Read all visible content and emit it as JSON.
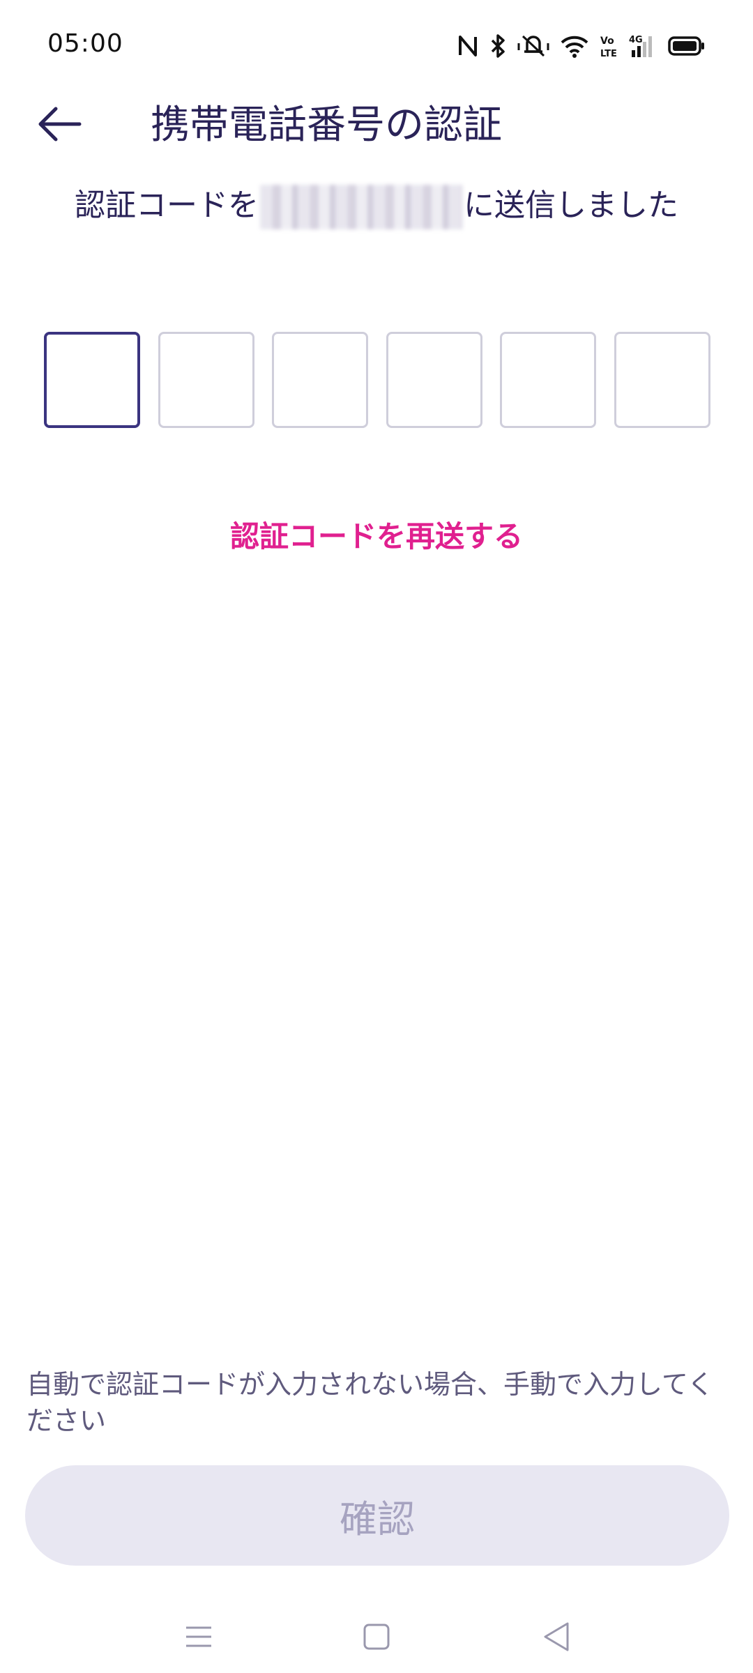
{
  "status_bar": {
    "time": "05:00",
    "icons": [
      "nfc-icon",
      "bluetooth-icon",
      "vibrate-icon",
      "wifi-icon",
      "volte-icon",
      "signal-4g-icon",
      "battery-icon"
    ]
  },
  "header": {
    "back_icon": "arrow-left-icon",
    "title": "携帯電話番号の認証"
  },
  "subtitle": {
    "prefix": "認証コードを",
    "suffix": "に送信しました"
  },
  "code_input": {
    "length": 6,
    "values": [
      "",
      "",
      "",
      "",
      "",
      ""
    ]
  },
  "resend_link": "認証コードを再送する",
  "hint": "自動で認証コードが入力されない場合、手動で入力してください",
  "confirm_button": "確認",
  "nav_bar": {
    "icons": [
      "menu-icon",
      "home-icon",
      "back-triangle-icon"
    ]
  },
  "colors": {
    "text_primary": "#2a2358",
    "accent_link": "#e0208f",
    "active_box_border": "#3b3480",
    "inactive_box_border": "#cfcedb",
    "button_bg": "#e8e7f2",
    "button_text": "#a6a3c0"
  }
}
